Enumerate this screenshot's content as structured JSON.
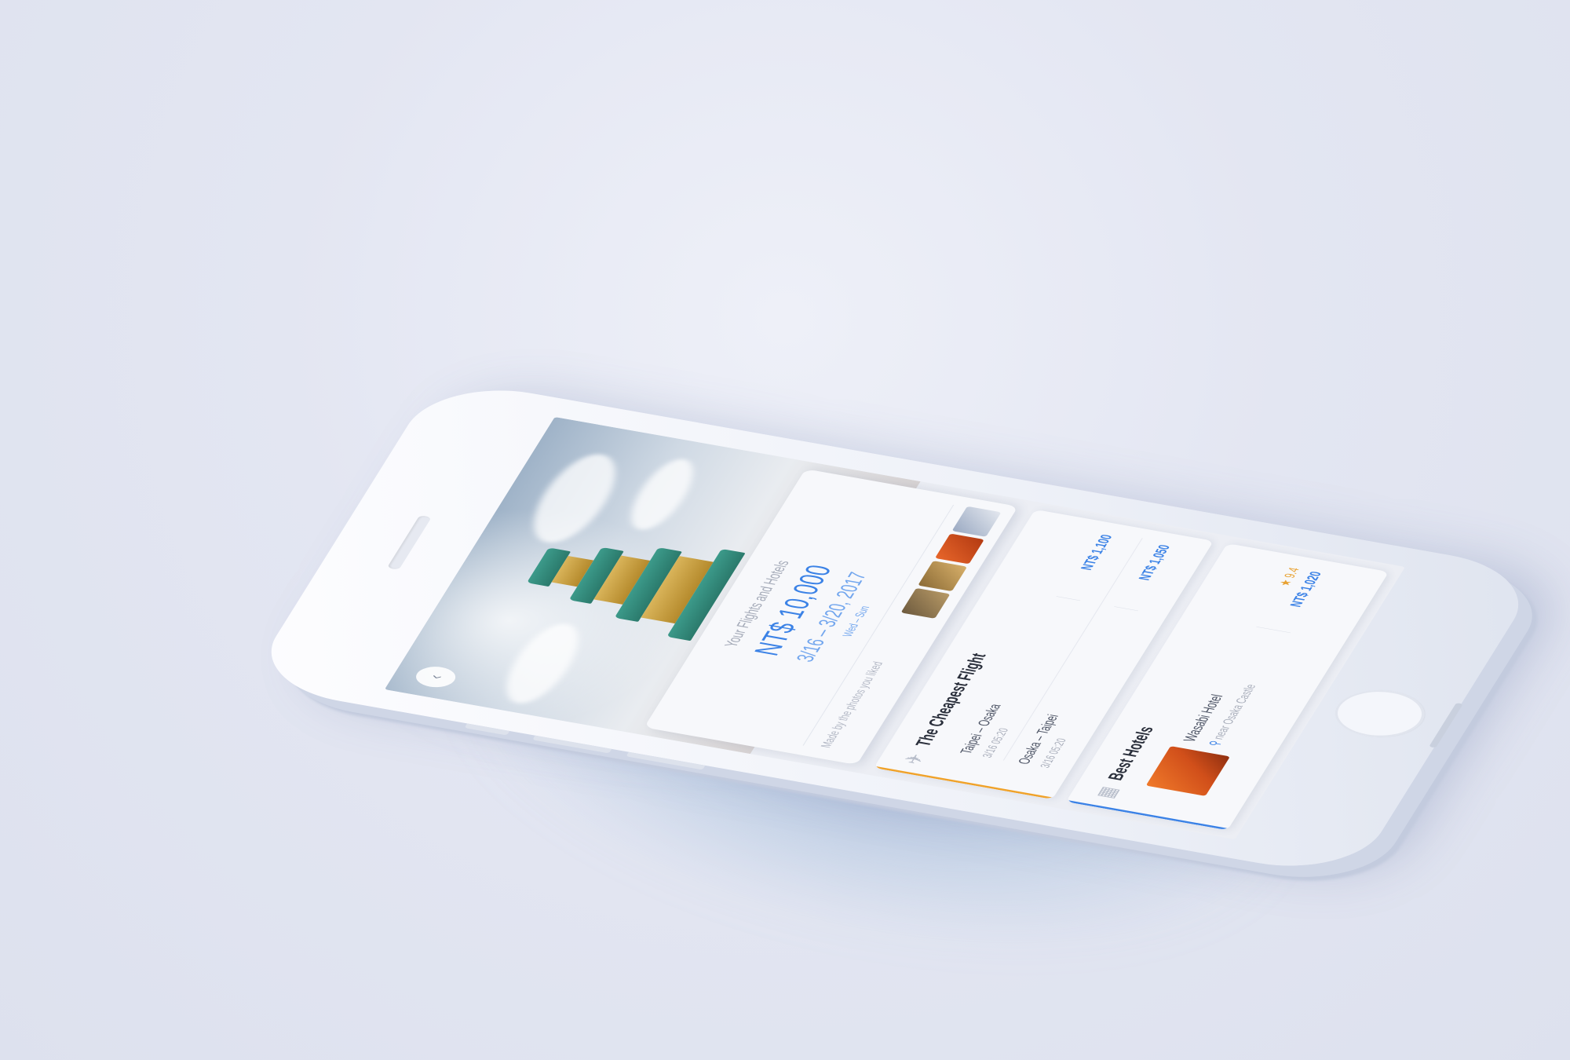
{
  "summary": {
    "label": "Your Flights and Hotels",
    "total_price": "NT$ 10,000",
    "date_range": "3/16 – 3/20, 2017",
    "weekday_range": "Wed  –  Sun",
    "made_by": "Made by the photos you liked"
  },
  "flight": {
    "title": "The Cheapest Flight",
    "icon": "airplane-icon",
    "accent_color": "#f0a229",
    "legs": [
      {
        "route": "Taipei  –  Osaka",
        "time": "3/16 05:20",
        "price": "NT$ 1,100"
      },
      {
        "route": "Osaka  –  Taipei",
        "time": "3/16 05:20",
        "price": "NT$ 1,050"
      }
    ]
  },
  "hotels": {
    "title": "Best Hotels",
    "icon": "building-icon",
    "accent_color": "#3b82e6",
    "items": [
      {
        "name": "Wasabi Hotel",
        "location": "near Osaka Castle",
        "rating": "★ 9.4",
        "price": "NT$ 1,020"
      }
    ]
  },
  "colors": {
    "accent_blue": "#3b82e6",
    "accent_orange": "#f0a229",
    "rating": "#e8a233"
  }
}
